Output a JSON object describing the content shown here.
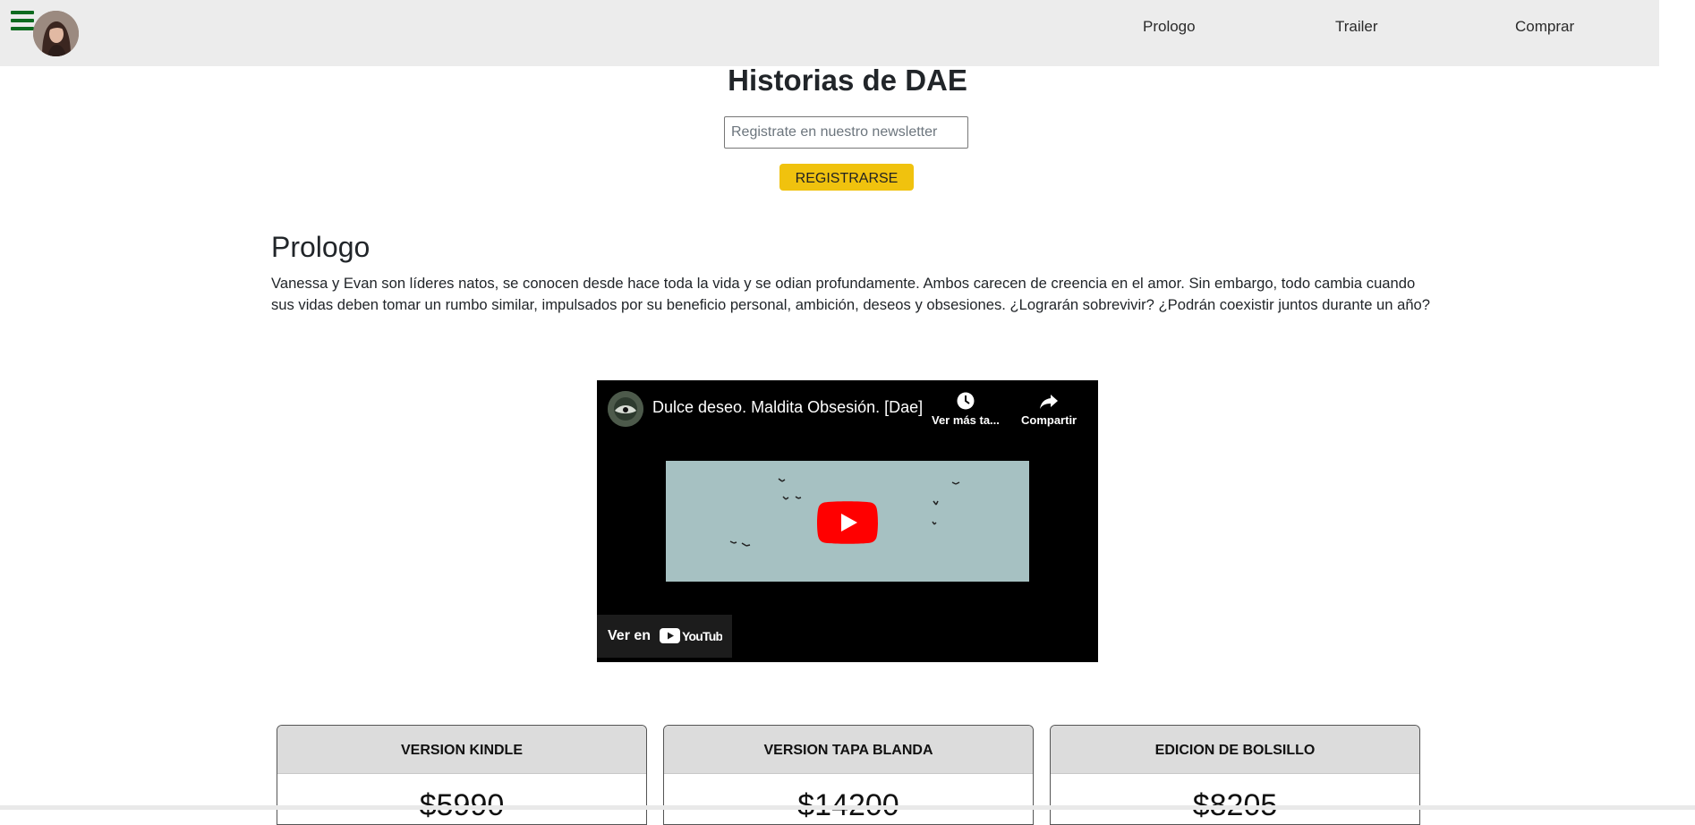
{
  "nav": {
    "links": [
      "Prologo",
      "Trailer",
      "Comprar"
    ]
  },
  "header": {
    "title": "Historias de DAE"
  },
  "newsletter": {
    "placeholder": "Registrate en nuestro newsletter",
    "button_label": "REGISTRARSE"
  },
  "prologue": {
    "title": "Prologo",
    "text": "Vanessa y Evan son líderes natos, se conocen desde hace toda la vida y se odian profundamente. Ambos carecen de creencia en el amor. Sin embargo, todo cambia cuando sus vidas deben tomar un rumbo similar, impulsados por su beneficio personal, ambición, deseos y obsesiones. ¿Lograrán sobrevivir? ¿Podrán coexistir juntos durante un año?"
  },
  "video": {
    "title": "Dulce deseo. Maldita Obsesión. [Dae]",
    "watch_later": "Ver más ta...",
    "share": "Compartir",
    "watch_on": "Ver en",
    "youtube": "YouTube"
  },
  "cards": [
    {
      "title": "VERSION KINDLE",
      "price": "$5990"
    },
    {
      "title": "VERSION TAPA BLANDA",
      "price": "$14200"
    },
    {
      "title": "EDICION DE BOLSILLO",
      "price": "$8205"
    }
  ],
  "icons": {
    "menu": "hamburger-icon",
    "watch_later": "clock-icon",
    "share": "share-arrow-icon",
    "play": "play-icon"
  },
  "colors": {
    "navbar_bg": "#ececec",
    "menu_icon": "#0d6b1f",
    "register_button": "#f0c20e",
    "card_header": "#dcdcdc",
    "youtube_red": "#ff0000"
  }
}
